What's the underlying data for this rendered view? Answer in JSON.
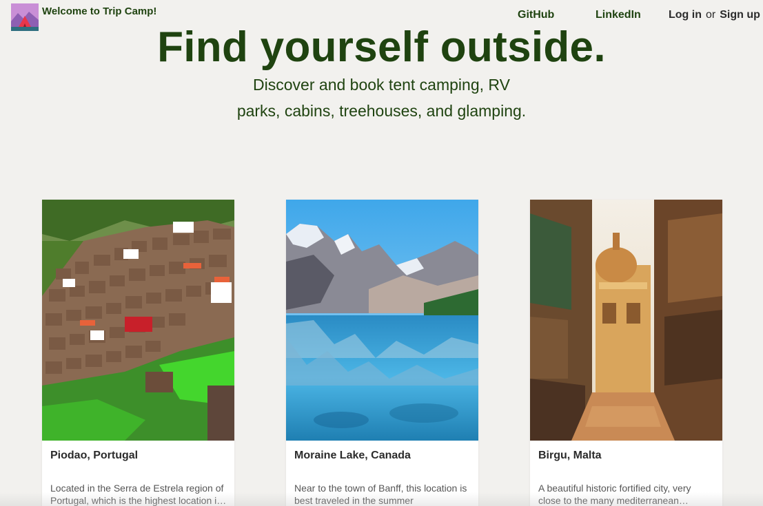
{
  "header": {
    "welcome": "Welcome to Trip Camp!",
    "nav": {
      "github": "GitHub",
      "linkedin": "LinkedIn"
    },
    "auth": {
      "login": "Log in",
      "or": "or",
      "signup": "Sign up"
    },
    "logo_icon": "tent-mountain-logo-icon"
  },
  "hero": {
    "title": "Find yourself outside.",
    "subtitle_line1": "Discover and book tent camping, RV",
    "subtitle_line2": "parks, cabins, treehouses, and glamping."
  },
  "cards": [
    {
      "title": "Piodao, Portugal",
      "description": "Located in the Serra de Estrela region of Portugal, which is the highest location i…",
      "image": "hillside-village-photo"
    },
    {
      "title": "Moraine Lake, Canada",
      "description": "Near to the town of Banff, this location is best traveled in the summer",
      "image": "mountain-lake-photo"
    },
    {
      "title": "Birgu, Malta",
      "description": "A beautiful historic fortified city, very close to the many mediterranean…",
      "image": "historic-street-photo"
    }
  ],
  "colors": {
    "background": "#f2f1ee",
    "brand_green": "#1f4310",
    "card_bg": "#ffffff",
    "text_dark": "#2b2b2b"
  }
}
